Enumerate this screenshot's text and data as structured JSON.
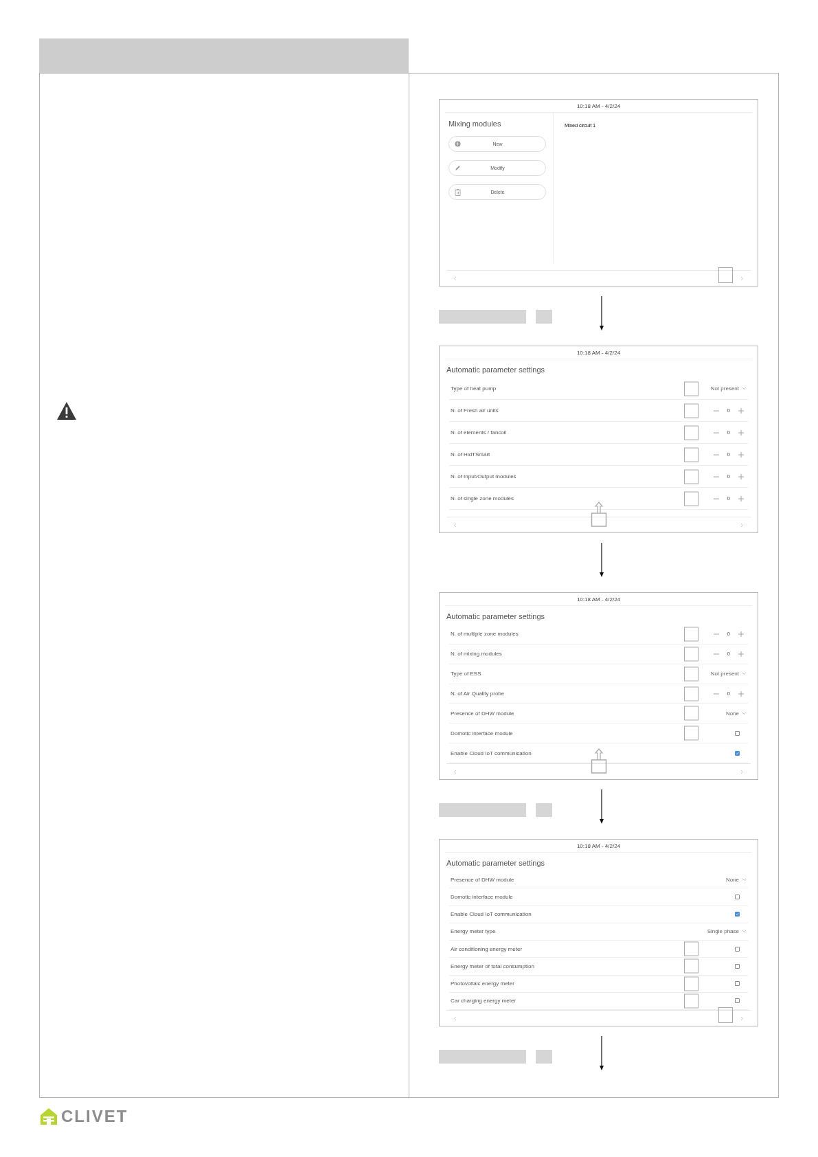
{
  "logo": {
    "text": "CLIVET"
  },
  "screens": [
    {
      "kind": "modules",
      "time": "10:18 AM - 4/2/24",
      "title": "Mixing modules",
      "callout": {
        "kind": "scroll-box"
      },
      "buttons": [
        {
          "label": "New"
        },
        {
          "label": "Modify"
        },
        {
          "label": "Delete"
        }
      ],
      "items": [
        "Mixed circuit 1"
      ],
      "next": {
        "labels": true
      }
    },
    {
      "kind": "settings",
      "time": "10:18 AM - 4/2/24",
      "title": "Automatic parameter settings",
      "callout": {
        "kind": "up-arrow"
      },
      "rows": [
        {
          "label": "Type of heat pump",
          "kind": "dropdown",
          "value": "Not present",
          "marked": true
        },
        {
          "label": "N. of Fresh air units",
          "kind": "stepper",
          "value": "0",
          "marked": true
        },
        {
          "label": "N. of elements / fancoil",
          "kind": "stepper",
          "value": "0",
          "marked": true
        },
        {
          "label": "N. of HidTSmart",
          "kind": "stepper",
          "value": "0",
          "marked": true
        },
        {
          "label": "N. of Input/Output modules",
          "kind": "stepper",
          "value": "0",
          "marked": true
        },
        {
          "label": "N. of single zone modules",
          "kind": "stepper",
          "value": "0",
          "marked": true
        }
      ],
      "next": {
        "labels": false
      }
    },
    {
      "kind": "settings",
      "time": "10:18 AM - 4/2/24",
      "title": "Automatic parameter settings",
      "callout": {
        "kind": "up-arrow"
      },
      "rows": [
        {
          "label": "N. of multiple zone modules",
          "kind": "stepper",
          "value": "0",
          "marked": true
        },
        {
          "label": "N. of mixing modules",
          "kind": "stepper",
          "value": "0",
          "marked": true
        },
        {
          "label": "Type of ESS",
          "kind": "dropdown",
          "value": "Not present",
          "marked": true
        },
        {
          "label": "N. of Air Quality probe",
          "kind": "stepper",
          "value": "0",
          "marked": true
        },
        {
          "label": "Presence of DHW module",
          "kind": "dropdown",
          "value": "None",
          "marked": true
        },
        {
          "label": "Domotic interface module",
          "kind": "checkbox",
          "checked": false,
          "marked": true
        },
        {
          "label": "Enable Cloud IoT communication",
          "kind": "checkbox",
          "checked": true,
          "marked": false
        }
      ],
      "next": {
        "labels": true
      }
    },
    {
      "kind": "settings",
      "time": "10:18 AM - 4/2/24",
      "title": "Automatic parameter settings",
      "callout": {
        "kind": "scroll-box"
      },
      "rows": [
        {
          "label": "Presence of DHW module",
          "kind": "dropdown",
          "value": "None",
          "marked": false
        },
        {
          "label": "Domotic interface module",
          "kind": "checkbox",
          "checked": false,
          "marked": false
        },
        {
          "label": "Enable Cloud IoT communication",
          "kind": "checkbox",
          "checked": true,
          "marked": false
        },
        {
          "label": "Energy meter type",
          "kind": "dropdown",
          "value": "Single phase",
          "marked": false
        },
        {
          "label": "Air conditioning energy meter",
          "kind": "checkbox",
          "checked": false,
          "marked": true
        },
        {
          "label": "Energy meter of total consumption",
          "kind": "checkbox",
          "checked": false,
          "marked": true
        },
        {
          "label": "Photovoltaic energy meter",
          "kind": "checkbox",
          "checked": false,
          "marked": true
        },
        {
          "label": "Car charging energy meter",
          "kind": "checkbox",
          "checked": false,
          "marked": true
        }
      ],
      "next": {
        "labels": true
      }
    }
  ]
}
